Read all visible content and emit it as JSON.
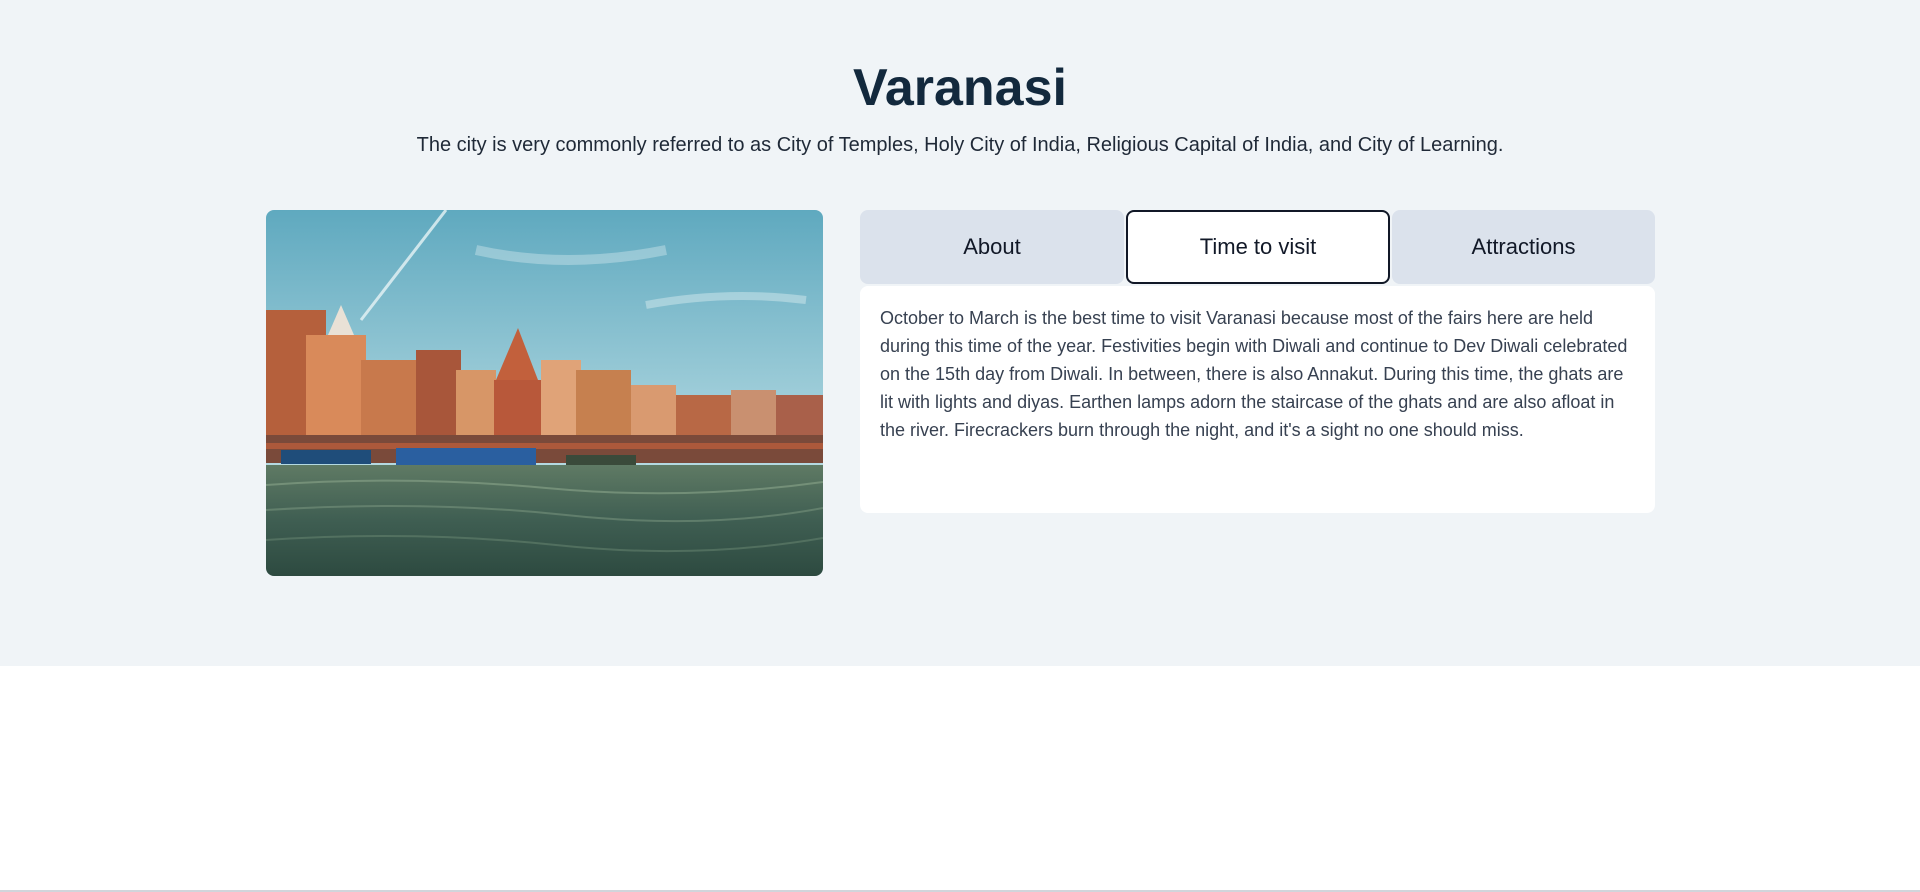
{
  "header": {
    "title": "Varanasi",
    "subtitle": "The city is very commonly referred to as City of Temples, Holy City of India, Religious Capital of India, and City of Learning."
  },
  "tabs": [
    {
      "label": "About",
      "active": false
    },
    {
      "label": "Time to visit",
      "active": true
    },
    {
      "label": "Attractions",
      "active": false
    }
  ],
  "panel": {
    "text": "October to March is the best time to visit Varanasi because most of the fairs here are held during this time of the year. Festivities begin with Diwali and continue to Dev Diwali celebrated on the 15th day from Diwali. In between, there is also Annakut. During this time, the ghats are lit with lights and diyas. Earthen lamps adorn the staircase of the ghats and are also afloat in the river. Firecrackers burn through the night, and it's a sight no one should miss."
  },
  "colors": {
    "hero_bg": "#f0f4f7",
    "title": "#13293d",
    "tab_inactive": "#dbe2ec",
    "tab_active_border": "#111827"
  }
}
